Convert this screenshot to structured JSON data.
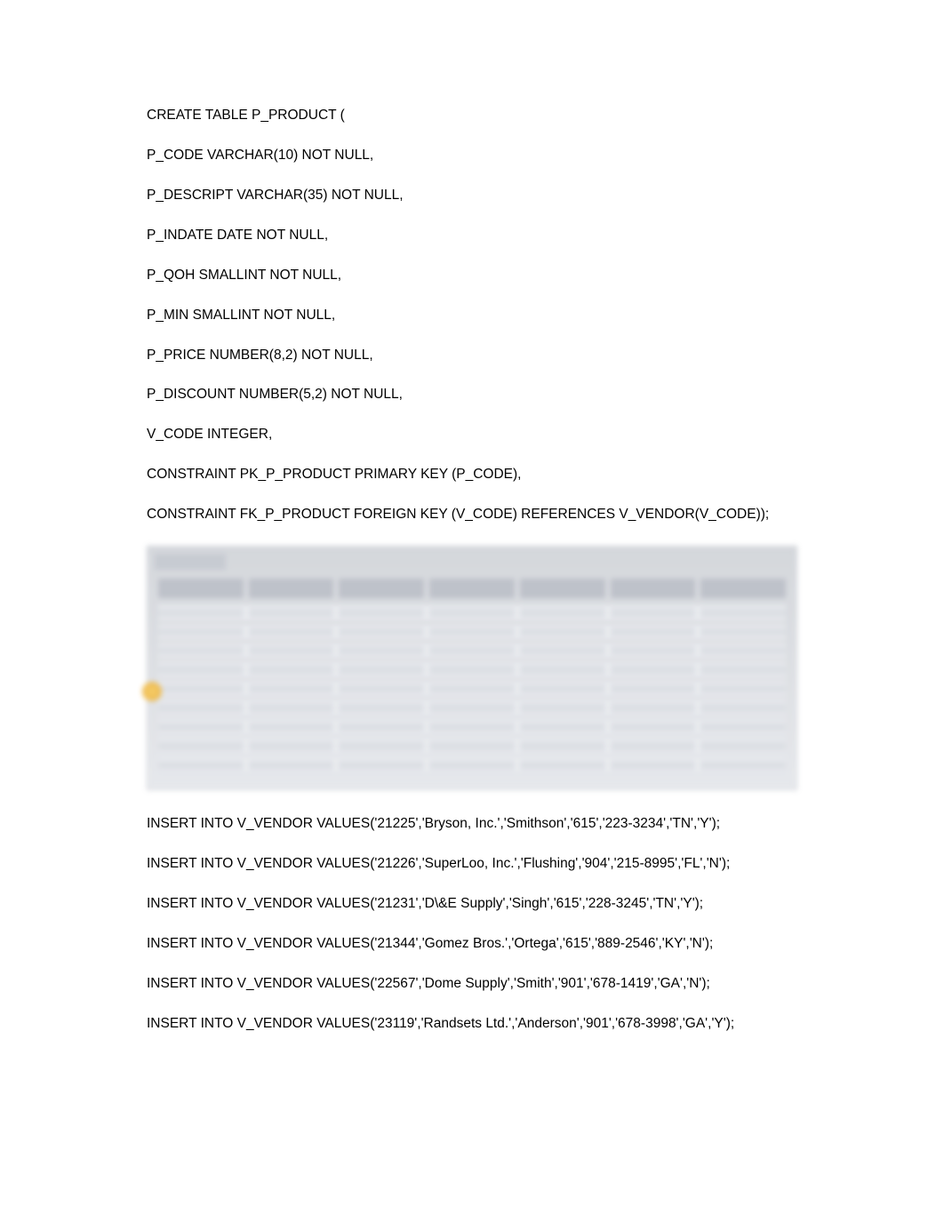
{
  "create_table": [
    "CREATE TABLE P_PRODUCT (",
    "P_CODE VARCHAR(10) NOT NULL,",
    "P_DESCRIPT VARCHAR(35) NOT NULL,",
    "P_INDATE DATE NOT NULL,",
    "P_QOH SMALLINT NOT NULL,",
    "P_MIN SMALLINT NOT NULL,",
    "P_PRICE NUMBER(8,2) NOT NULL,",
    "P_DISCOUNT NUMBER(5,2) NOT NULL,",
    "V_CODE INTEGER,",
    "CONSTRAINT PK_P_PRODUCT PRIMARY KEY (P_CODE),",
    "CONSTRAINT FK_P_PRODUCT FOREIGN KEY (V_CODE) REFERENCES V_VENDOR(V_CODE));"
  ],
  "inserts": [
    "INSERT INTO V_VENDOR VALUES('21225','Bryson, Inc.','Smithson','615','223-3234','TN','Y');",
    "INSERT INTO V_VENDOR VALUES('21226','SuperLoo, Inc.','Flushing','904','215-8995','FL','N');",
    "INSERT INTO V_VENDOR VALUES('21231','D\\&E Supply','Singh','615','228-3245','TN','Y');",
    "INSERT INTO V_VENDOR VALUES('21344','Gomez Bros.','Ortega','615','889-2546','KY','N');",
    "INSERT INTO V_VENDOR VALUES('22567','Dome Supply','Smith','901','678-1419','GA','N');",
    "INSERT INTO V_VENDOR VALUES('23119','Randsets Ltd.','Anderson','901','678-3998','GA','Y');"
  ]
}
